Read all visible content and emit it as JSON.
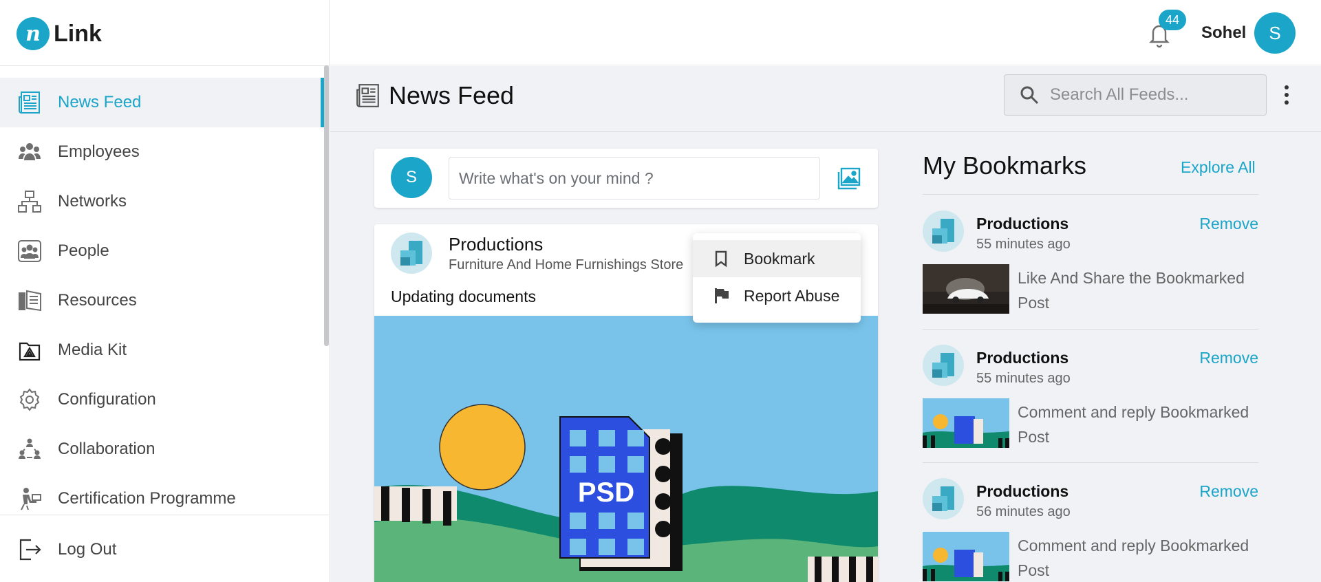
{
  "app": {
    "logo_letter": "n",
    "logo_name": "Link",
    "accent": "#1aa5c9"
  },
  "sidebar": {
    "items": [
      {
        "label": "News Feed",
        "icon": "newspaper-icon",
        "active": true
      },
      {
        "label": "Employees",
        "icon": "employees-icon"
      },
      {
        "label": "Networks",
        "icon": "network-icon"
      },
      {
        "label": "People",
        "icon": "people-icon"
      },
      {
        "label": "Resources",
        "icon": "book-icon"
      },
      {
        "label": "Media Kit",
        "icon": "media-kit-icon"
      },
      {
        "label": "Configuration",
        "icon": "gear-icon"
      },
      {
        "label": "Collaboration",
        "icon": "collaboration-icon"
      },
      {
        "label": "Certification Programme",
        "icon": "certification-icon"
      }
    ],
    "logout_label": "Log Out"
  },
  "topbar": {
    "notification_count": "44",
    "user_name": "Sohel",
    "avatar_letter": "S"
  },
  "header": {
    "title": "News Feed",
    "search_placeholder": "Search All Feeds..."
  },
  "composer": {
    "avatar_letter": "S",
    "placeholder": "Write what's on your mind ?"
  },
  "post": {
    "author": "Productions",
    "subtitle": "Furniture And Home Furnishings Store",
    "text": "Updating documents",
    "image_label": "PSD"
  },
  "post_menu": {
    "items": [
      "Bookmark",
      "Report Abuse"
    ]
  },
  "bookmarks": {
    "title": "My Bookmarks",
    "explore_label": "Explore All",
    "remove_label": "Remove",
    "items": [
      {
        "author": "Productions",
        "time": "55 minutes ago",
        "text": "Like And Share the Bookmarked Post",
        "thumb": "car-photo"
      },
      {
        "author": "Productions",
        "time": "55 minutes ago",
        "text": "Comment and reply Bookmarked Post",
        "thumb": "psd-illustration"
      },
      {
        "author": "Productions",
        "time": "56 minutes ago",
        "text": "Comment and reply Bookmarked Post",
        "thumb": "psd-illustration"
      }
    ]
  }
}
